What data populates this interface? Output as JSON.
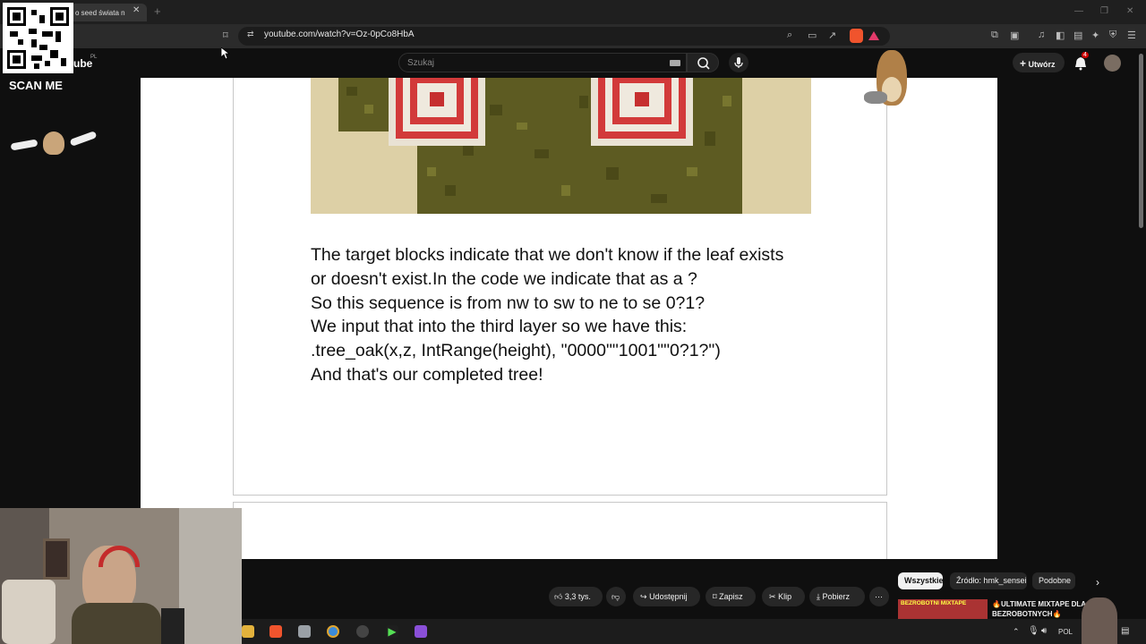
{
  "browser": {
    "tab_title": "o seed świata n",
    "tab_close": "✕",
    "new_tab": "+",
    "url": "youtube.com/watch?v=Oz-0pCo8HbA"
  },
  "youtube": {
    "logo_partial": "ube",
    "logo_region": "PL",
    "search_placeholder": "Szukaj",
    "create_label": "Utwórz",
    "notification_count": "4"
  },
  "overlay": {
    "scan_label": "SCAN ME"
  },
  "slide": {
    "lines": [
      "The target blocks indicate that we don't know if the leaf exists",
      "or doesn't exist.In the code we indicate that as a ?",
      "So this sequence is from nw to sw to ne to se 0?1?",
      "We input that into the third layer so we have this:",
      ".tree_oak(x,z, IntRange(height), \"0000\"\"1001\"\"0?1?\")",
      "And that's our completed tree!"
    ]
  },
  "actions": {
    "likes": "3,3 tys.",
    "share": "Udostępnij",
    "save": "Zapisz",
    "clip": "Klip",
    "download": "Pobierz",
    "more": "⋯"
  },
  "chips": {
    "all": "Wszystkie",
    "source": "Źródło: hmk_sensei",
    "similar": "Podobne"
  },
  "recommendation": {
    "thumb_text": "BEZROBOTNI MIXTAPE",
    "title_line1": "🔥ULTIMATE MIXTAPE DLA",
    "title_line2": "BEZROBOTNYCH🔥"
  },
  "taskbar": {
    "lang": "POL"
  },
  "colors": {
    "yt_bg": "#0f0f0f",
    "chip_active": "#f1f1f1",
    "notification_red": "#cc0000"
  }
}
